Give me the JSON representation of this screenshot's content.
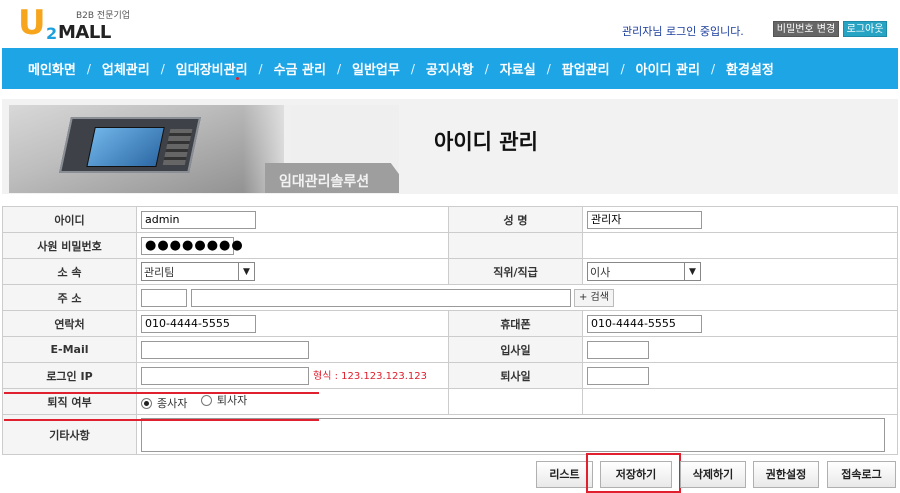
{
  "header": {
    "logo_tagline": "B2B 전문기업",
    "logo_letter": "U",
    "logo_2": "2",
    "logo_mall": "MALL",
    "login_message": "관리자님 로그인 중입니다.",
    "change_password_label": "비밀번호 변경",
    "logout_label": "로그아웃"
  },
  "nav": {
    "items": [
      "메인화면",
      "업체관리",
      "임대장비관리",
      "수금 관리",
      "일반업무",
      "공지사항",
      "자료실",
      "팝업관리",
      "아이디 관리",
      "환경설정"
    ],
    "separator": "/"
  },
  "banner": {
    "title": "아이디 관리",
    "tab_label": "임대관리솔루션"
  },
  "form": {
    "id_label": "아이디",
    "id_value": "admin",
    "name_label": "성 명",
    "name_value": "관리자",
    "password_label": "사원 비밀번호",
    "password_value": "●●●●●●●●",
    "dept_label": "소 속",
    "dept_value": "관리팀",
    "position_label": "직위/직급",
    "position_value": "이사",
    "address_label": "주 소",
    "address_search": "+ 검색",
    "phone_label": "연락처",
    "phone_value": "010-4444-5555",
    "mobile_label": "휴대폰",
    "mobile_value": "010-4444-5555",
    "email_label": "E-Mail",
    "hire_label": "입사일",
    "ip_label": "로그인 IP",
    "ip_hint": "형식 : 123.123.123.123",
    "leave_label": "퇴사일",
    "status_label": "퇴직 여부",
    "status_employed": "종사자",
    "status_retired": "퇴사자",
    "notes_label": "기타사항"
  },
  "buttons": {
    "list": "리스트",
    "save": "저장하기",
    "delete": "삭제하기",
    "permissions": "권한설정",
    "access_log": "접속로그"
  },
  "colors": {
    "nav_bg": "#1ea5e6",
    "highlight_red": "#e0202e",
    "logout_bg": "#27a3c4"
  }
}
